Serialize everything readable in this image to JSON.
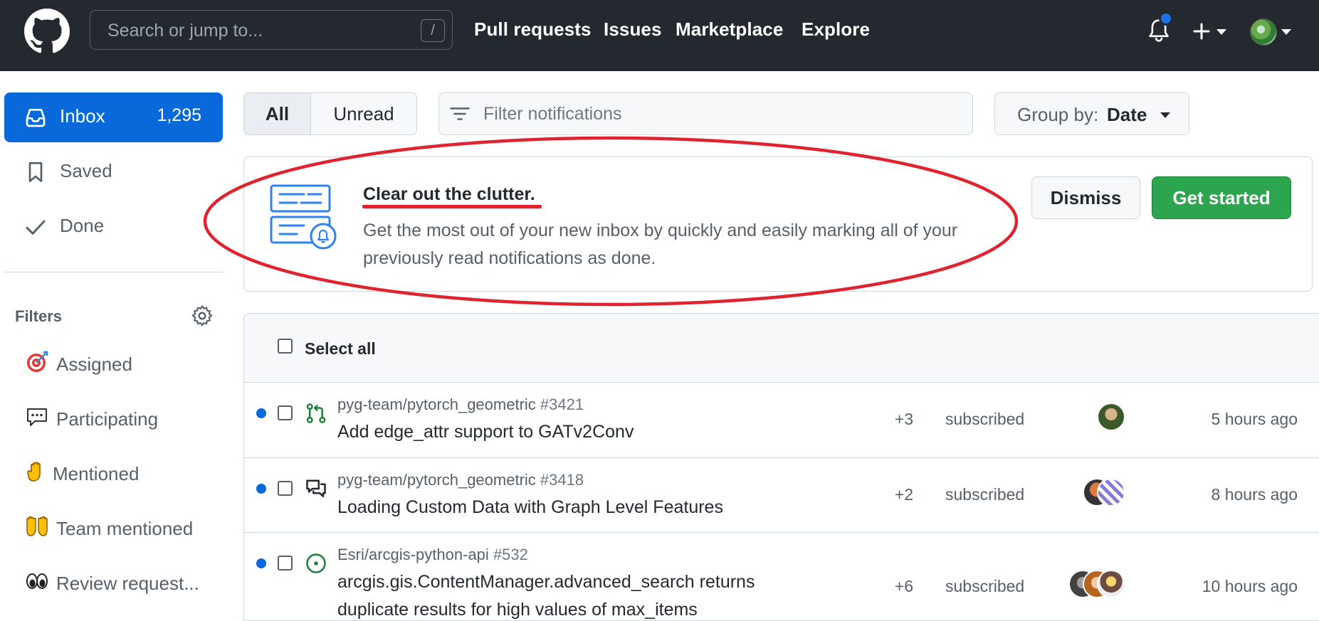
{
  "header": {
    "search_placeholder": "Search or jump to...",
    "search_shortcut": "/",
    "nav": [
      "Pull requests",
      "Issues",
      "Marketplace",
      "Explore"
    ]
  },
  "sidebar": {
    "inbox": {
      "label": "Inbox",
      "count": "1,295",
      "icon": "inbox-icon"
    },
    "saved": {
      "label": "Saved",
      "icon": "bookmark-icon"
    },
    "done": {
      "label": "Done",
      "icon": "check-icon"
    },
    "filters_title": "Filters",
    "filters": [
      {
        "label": "Assigned",
        "icon": "direct-hit-emoji"
      },
      {
        "label": "Participating",
        "icon": "speech-balloon-emoji"
      },
      {
        "label": "Mentioned",
        "icon": "raised-hand-emoji"
      },
      {
        "label": "Team mentioned",
        "icon": "raising-hands-emoji"
      },
      {
        "label": "Review request...",
        "icon": "eyes-emoji"
      }
    ]
  },
  "toolbar": {
    "tab_all": "All",
    "tab_unread": "Unread",
    "filter_placeholder": "Filter notifications",
    "group_by_label": "Group by:",
    "group_by_value": "Date"
  },
  "banner": {
    "title": "Clear out the clutter.",
    "description": "Get the most out of your new inbox by quickly and easily marking all of your previously read notifications as done.",
    "dismiss": "Dismiss",
    "get_started": "Get started"
  },
  "list": {
    "select_all": "Select all",
    "rows": [
      {
        "repo": "pyg-team/pytorch_geometric",
        "number": "#3421",
        "title": "Add edge_attr support to GATv2Conv",
        "count": "+3",
        "reason": "subscribed",
        "time": "5 hours ago",
        "type_icon": "pull-request-icon"
      },
      {
        "repo": "pyg-team/pytorch_geometric",
        "number": "#3418",
        "title": "Loading Custom Data with Graph Level Features",
        "count": "+2",
        "reason": "subscribed",
        "time": "8 hours ago",
        "type_icon": "discussion-icon"
      },
      {
        "repo": "Esri/arcgis-python-api",
        "number": "#532",
        "title": "arcgis.gis.ContentManager.advanced_search returns duplicate results for high values of max_items",
        "count": "+6",
        "reason": "subscribed",
        "time": "10 hours ago",
        "type_icon": "issue-opened-icon"
      }
    ]
  },
  "colors": {
    "header_bg": "#24292f",
    "accent_blue": "#0969da",
    "green_button": "#2da44e",
    "annotation_red": "#e0242f"
  }
}
